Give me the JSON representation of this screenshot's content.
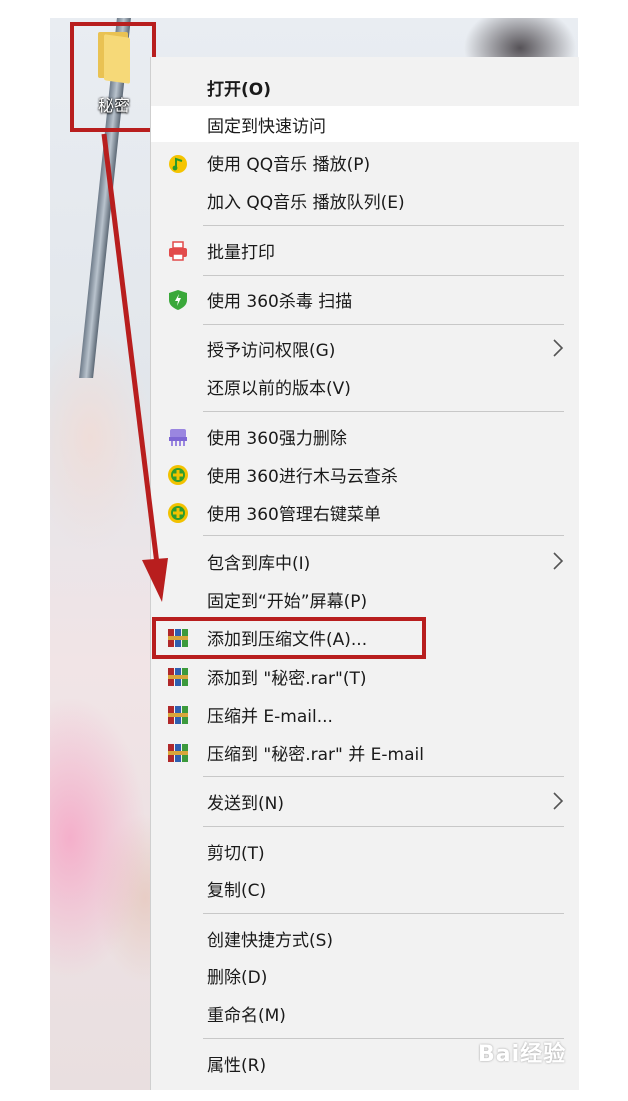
{
  "desktop": {
    "folder_label": "秘密"
  },
  "menu": {
    "items": [
      {
        "label": "打开(O)"
      },
      {
        "label": "固定到快速访问"
      },
      {
        "label": "使用 QQ音乐 播放(P)",
        "icon": "qq-music-icon"
      },
      {
        "label": "加入 QQ音乐 播放队列(E)"
      },
      {
        "label": "批量打印",
        "icon": "printer-icon"
      },
      {
        "label": "使用 360杀毒 扫描",
        "icon": "360-antivirus-shield-icon"
      },
      {
        "label": "授予访问权限(G)"
      },
      {
        "label": "还原以前的版本(V)"
      },
      {
        "label": "使用 360强力删除",
        "icon": "360-shredder-icon"
      },
      {
        "label": "使用 360进行木马云查杀",
        "icon": "360-safeguard-icon"
      },
      {
        "label": "使用 360管理右键菜单",
        "icon": "360-safeguard-icon"
      },
      {
        "label": "包含到库中(I)"
      },
      {
        "label": "固定到“开始”屏幕(P)"
      },
      {
        "label": "添加到压缩文件(A)...",
        "icon": "winrar-icon"
      },
      {
        "label": "添加到 \"秘密.rar\"(T)",
        "icon": "winrar-icon"
      },
      {
        "label": "压缩并 E-mail...",
        "icon": "winrar-icon"
      },
      {
        "label": "压缩到 \"秘密.rar\" 并 E-mail",
        "icon": "winrar-icon"
      },
      {
        "label": "发送到(N)"
      },
      {
        "label": "剪切(T)"
      },
      {
        "label": "复制(C)"
      },
      {
        "label": "创建快捷方式(S)"
      },
      {
        "label": "删除(D)"
      },
      {
        "label": "重命名(M)"
      },
      {
        "label": "属性(R)"
      }
    ]
  },
  "watermark": {
    "text": "Bai经验"
  },
  "colors": {
    "highlight_red": "#b81e1e",
    "menu_bg": "#f2f2f2",
    "hover_bg": "#ffffff"
  }
}
